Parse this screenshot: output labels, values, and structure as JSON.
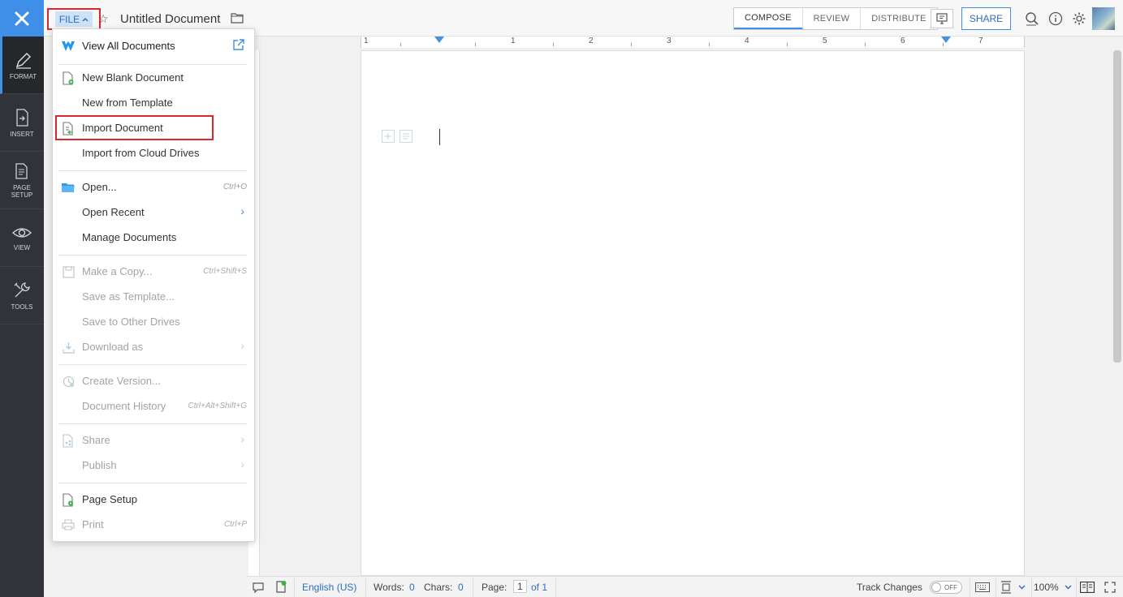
{
  "topbar": {
    "file_label": "FILE",
    "doc_title": "Untitled Document",
    "modes": [
      "COMPOSE",
      "REVIEW",
      "DISTRIBUTE"
    ],
    "share_label": "SHARE"
  },
  "sidebar": {
    "items": [
      {
        "label": "FORMAT",
        "icon": "format-icon"
      },
      {
        "label": "INSERT",
        "icon": "insert-icon"
      },
      {
        "label": "PAGE SETUP",
        "icon": "page-setup-icon"
      },
      {
        "label": "VIEW",
        "icon": "eye-icon"
      },
      {
        "label": "TOOLS",
        "icon": "tools-icon"
      }
    ]
  },
  "ruler": {
    "numbers": [
      "1",
      "1",
      "2",
      "3",
      "4",
      "5",
      "6",
      "7"
    ]
  },
  "menu": {
    "view_all": "View All Documents",
    "new_blank": "New Blank Document",
    "new_template": "New from Template",
    "import_document": "Import Document",
    "import_cloud": "Import from Cloud Drives",
    "open": "Open...",
    "open_shortcut": "Ctrl+O",
    "open_recent": "Open Recent",
    "manage_documents": "Manage Documents",
    "make_copy": "Make a Copy...",
    "make_copy_shortcut": "Ctrl+Shift+S",
    "save_template": "Save as Template...",
    "save_other": "Save to Other Drives",
    "download_as": "Download as",
    "create_version": "Create Version...",
    "document_history": "Document History",
    "document_history_shortcut": "Ctrl+Alt+Shift+G",
    "share": "Share",
    "publish": "Publish",
    "page_setup": "Page Setup",
    "print": "Print",
    "print_shortcut": "Ctrl+P"
  },
  "statusbar": {
    "language": "English (US)",
    "words_label": "Words:",
    "words_value": "0",
    "chars_label": "Chars:",
    "chars_value": "0",
    "page_label": "Page:",
    "page_current": "1",
    "page_of": "of 1",
    "track_changes": "Track Changes",
    "toggle_state": "OFF",
    "zoom": "100%"
  },
  "colors": {
    "accent": "#3f8ee8",
    "sidebar_bg": "#303338",
    "highlight_red": "#d9282f"
  }
}
